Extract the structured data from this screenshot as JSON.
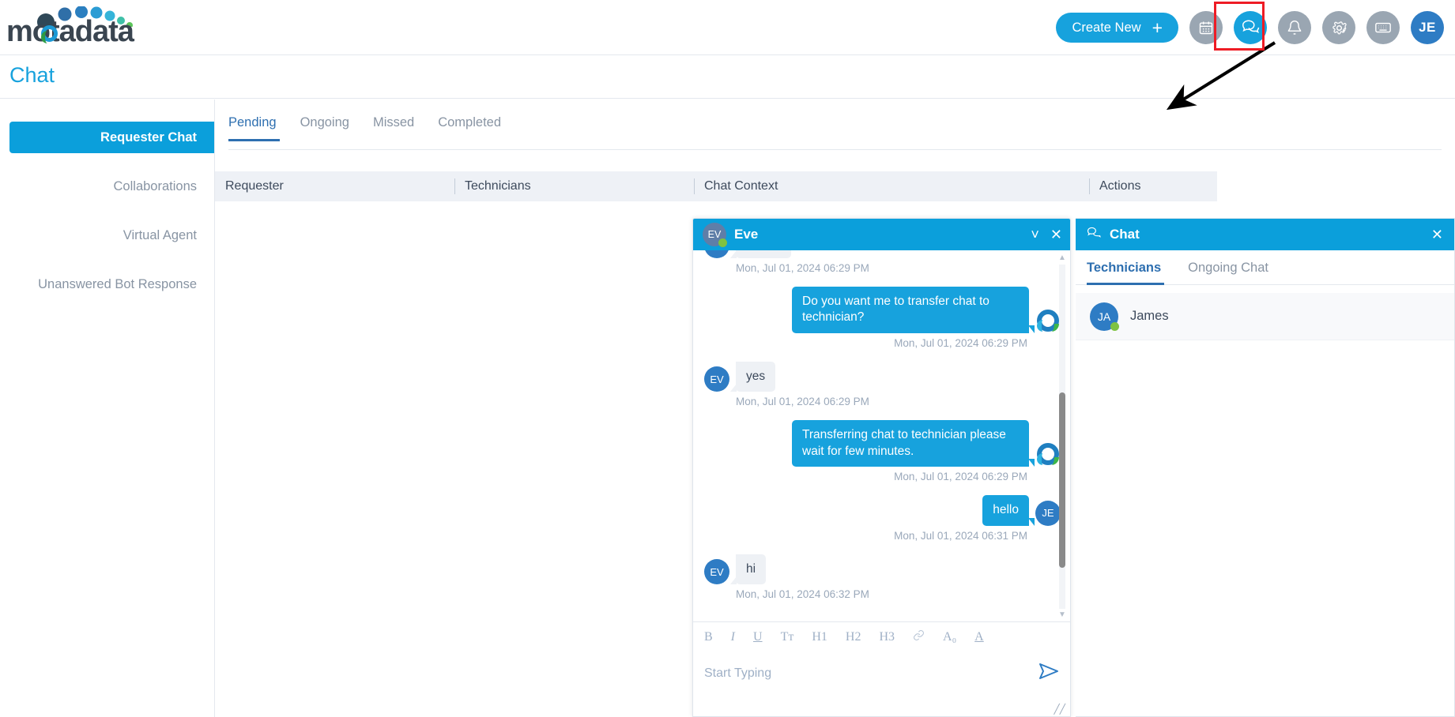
{
  "header": {
    "logo_text": "motadata",
    "create_button": "Create New",
    "icons": [
      {
        "name": "calendar-icon",
        "glyph": "calendar"
      },
      {
        "name": "chat-icon",
        "glyph": "chat"
      },
      {
        "name": "notification-bell-icon",
        "glyph": "bell"
      },
      {
        "name": "settings-gear-icon",
        "glyph": "gear"
      },
      {
        "name": "keyboard-icon",
        "glyph": "keyboard"
      }
    ],
    "avatar_initials": "JE",
    "accent_color": "#17a2dd",
    "annotation_box_color": "#ee1c25"
  },
  "page": {
    "title": "Chat"
  },
  "sidebar": {
    "items": [
      {
        "label": "Requester Chat",
        "active": true
      },
      {
        "label": "Collaborations",
        "active": false
      },
      {
        "label": "Virtual Agent",
        "active": false
      },
      {
        "label": "Unanswered Bot Response",
        "active": false
      }
    ]
  },
  "main": {
    "tabs": [
      {
        "label": "Pending",
        "active": true
      },
      {
        "label": "Ongoing",
        "active": false
      },
      {
        "label": "Missed",
        "active": false
      },
      {
        "label": "Completed",
        "active": false
      }
    ],
    "table": {
      "columns": [
        "Requester",
        "Technicians",
        "Chat Context",
        "Actions"
      ],
      "rows": []
    }
  },
  "chat_window": {
    "avatar_initials": "EV",
    "title": "Eve",
    "minimize_icon": "chevron-down-icon",
    "close_icon": "close-icon",
    "messages": [
      {
        "direction": "in",
        "avatar": "EV",
        "text": "",
        "timestamp": "Mon, Jul 01, 2024 06:29 PM",
        "partial": true
      },
      {
        "direction": "out",
        "avatar": "bot",
        "text": "Do you want me to transfer chat to technician?",
        "timestamp": "Mon, Jul 01, 2024 06:29 PM"
      },
      {
        "direction": "in",
        "avatar": "EV",
        "text": "yes",
        "timestamp": "Mon, Jul 01, 2024 06:29 PM"
      },
      {
        "direction": "out",
        "avatar": "bot",
        "text": "Transferring chat to technician please wait for few minutes.",
        "timestamp": "Mon, Jul 01, 2024 06:29 PM"
      },
      {
        "direction": "out",
        "avatar": "JE",
        "text": "hello",
        "timestamp": "Mon, Jul 01, 2024 06:31 PM"
      },
      {
        "direction": "in",
        "avatar": "EV",
        "text": "hi",
        "timestamp": "Mon, Jul 01, 2024 06:32 PM"
      }
    ],
    "editor": {
      "toolbar": [
        "B",
        "I",
        "U",
        "Tт",
        "H1",
        "H2",
        "H3",
        "link",
        "A₀",
        "A"
      ],
      "placeholder": "Start Typing",
      "send_icon": "send-icon"
    }
  },
  "right_panel": {
    "title": "Chat",
    "title_icon": "chat-icon",
    "close_icon": "close-icon",
    "tabs": [
      {
        "label": "Technicians",
        "active": true
      },
      {
        "label": "Ongoing Chat",
        "active": false
      }
    ],
    "technicians": [
      {
        "initials": "JA",
        "name": "James",
        "status": "online"
      }
    ]
  }
}
